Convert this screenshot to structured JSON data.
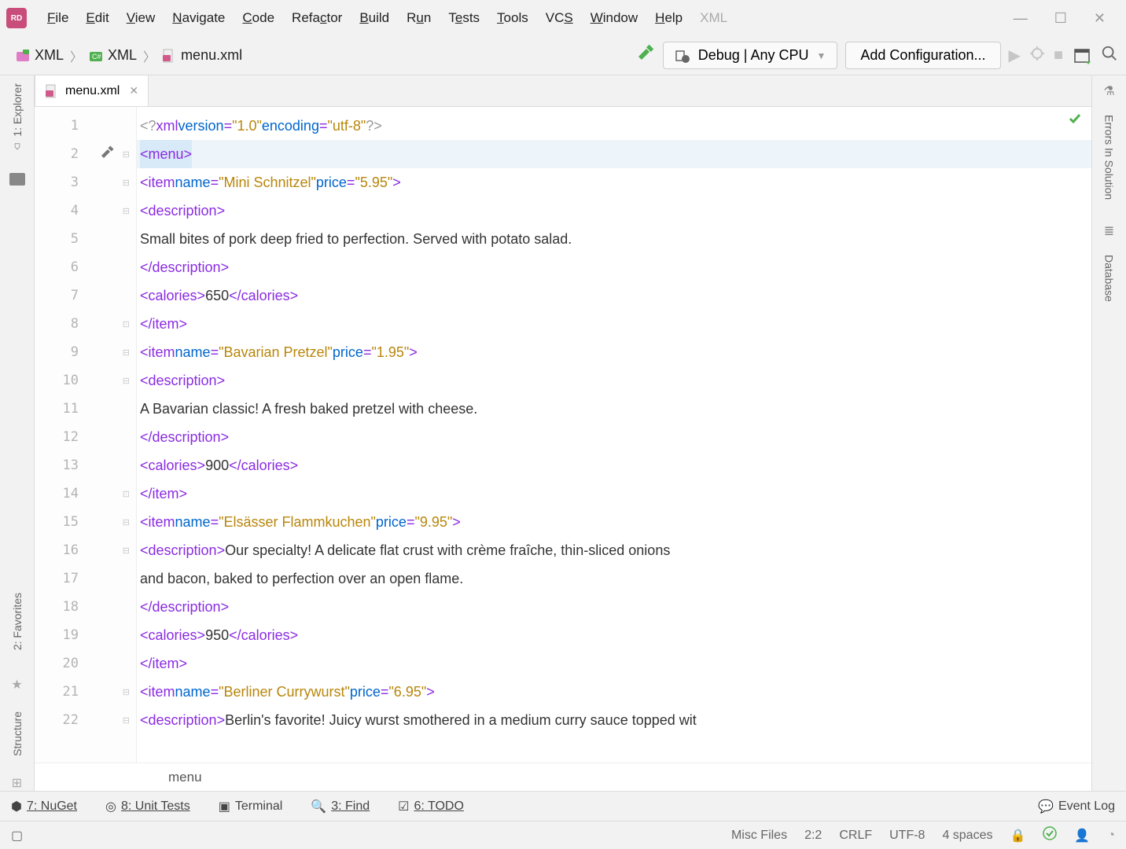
{
  "app": {
    "id": "RD"
  },
  "menu": {
    "items": [
      "File",
      "Edit",
      "View",
      "Navigate",
      "Code",
      "Refactor",
      "Build",
      "Run",
      "Tests",
      "Tools",
      "VCS",
      "Window",
      "Help"
    ],
    "extra": "XML",
    "ul": [
      0,
      0,
      0,
      0,
      0,
      4,
      0,
      1,
      1,
      0,
      2,
      0,
      0
    ]
  },
  "crumbs": {
    "a": "XML",
    "b": "XML",
    "c": "menu.xml"
  },
  "toolbar": {
    "config": "Debug | Any CPU",
    "add": "Add Configuration..."
  },
  "tab": {
    "name": "menu.xml"
  },
  "linecount": 22,
  "code": [
    {
      "type": "pi",
      "parts": [
        "<?",
        "xml",
        " ",
        "version",
        "=",
        "\"1.0\"",
        " ",
        "encoding",
        "=",
        "\"utf-8\"",
        "?>"
      ]
    },
    {
      "type": "open",
      "indent": 0,
      "tag": "menu",
      "hl": true
    },
    {
      "type": "openattr",
      "indent": 1,
      "tag": "item",
      "attrs": [
        [
          "name",
          "Mini Schnitzel"
        ],
        [
          "price",
          "5.95"
        ]
      ]
    },
    {
      "type": "open",
      "indent": 2,
      "tag": "description"
    },
    {
      "type": "text",
      "indent": 3,
      "text": "Small bites of pork deep fried to perfection. Served with potato salad."
    },
    {
      "type": "close",
      "indent": 2,
      "tag": "description"
    },
    {
      "type": "wraptag",
      "indent": 2,
      "tag": "calories",
      "text": "650"
    },
    {
      "type": "close",
      "indent": 1,
      "tag": "item"
    },
    {
      "type": "openattr",
      "indent": 1,
      "tag": "item",
      "attrs": [
        [
          "name",
          "Bavarian Pretzel"
        ],
        [
          "price",
          "1.95"
        ]
      ]
    },
    {
      "type": "open",
      "indent": 2,
      "tag": "description"
    },
    {
      "type": "text",
      "indent": 3,
      "text": "A Bavarian classic! A fresh baked pretzel with cheese."
    },
    {
      "type": "close",
      "indent": 2,
      "tag": "description"
    },
    {
      "type": "wraptag",
      "indent": 2,
      "tag": "calories",
      "text": "900"
    },
    {
      "type": "close",
      "indent": 1,
      "tag": "item"
    },
    {
      "type": "openattr",
      "indent": 1,
      "tag": "item",
      "attrs": [
        [
          "name",
          "Elsässer Flammkuchen"
        ],
        [
          "price",
          "9.95"
        ]
      ]
    },
    {
      "type": "opentext",
      "indent": 2,
      "tag": "description",
      "text": "Our specialty! A delicate flat crust with crème fraîche, thin-sliced onions"
    },
    {
      "type": "text",
      "indent": 3,
      "text": "and bacon, baked to perfection over an open flame."
    },
    {
      "type": "close",
      "indent": 2,
      "tag": "description"
    },
    {
      "type": "wraptag",
      "indent": 2,
      "tag": "calories",
      "text": "950"
    },
    {
      "type": "close",
      "indent": 1,
      "tag": "item"
    },
    {
      "type": "openattr",
      "indent": 1,
      "tag": "item",
      "attrs": [
        [
          "name",
          "Berliner Currywurst"
        ],
        [
          "price",
          "6.95"
        ]
      ]
    },
    {
      "type": "opentext",
      "indent": 2,
      "tag": "description",
      "text": "Berlin's favorite! Juicy wurst smothered in a medium curry sauce topped wit"
    }
  ],
  "breadcrumb": "menu",
  "bottom": {
    "nuget": "7: NuGet",
    "unit": "8: Unit Tests",
    "terminal": "Terminal",
    "find": "3: Find",
    "todo": "6: TODO",
    "event": "Event Log"
  },
  "status": {
    "misc": "Misc Files",
    "pos": "2:2",
    "eol": "CRLF",
    "enc": "UTF-8",
    "indent": "4 spaces"
  },
  "right": {
    "errors": "Errors In Solution",
    "db": "Database"
  },
  "left": {
    "explorer": "1: Explorer",
    "fav": "2: Favorites",
    "struct": "Structure"
  }
}
